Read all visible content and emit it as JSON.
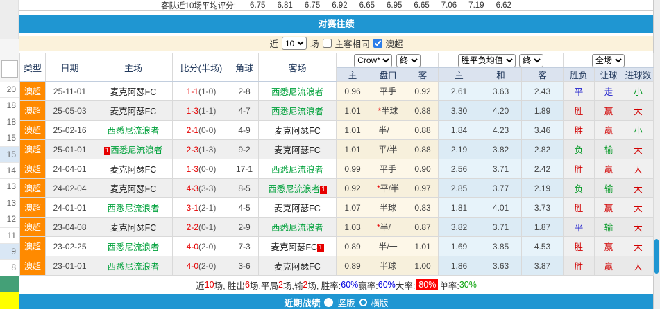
{
  "avg_scores": {
    "label": "客队近10场平均评分:",
    "values": [
      "6.75",
      "6.81",
      "6.75",
      "6.92",
      "6.65",
      "6.95",
      "6.65",
      "7.06",
      "7.19",
      "6.62"
    ]
  },
  "section_title": "对赛往绩",
  "filter": {
    "near": "近",
    "count": "10",
    "unit": "场",
    "same_venue": "主客相同",
    "same_venue_checked": false,
    "league": "澳超",
    "league_checked": true
  },
  "selectors": {
    "bookmaker": "Crow*",
    "final_left": "终",
    "average": "胜平负均值",
    "final_right": "终",
    "scope": "全场"
  },
  "headers": {
    "type": "类型",
    "date": "日期",
    "home": "主场",
    "score": "比分(半场)",
    "corner": "角球",
    "away": "客场",
    "o_home": "主",
    "o_handicap": "盘口",
    "o_away": "客",
    "a_home": "主",
    "a_draw": "和",
    "a_away": "客",
    "r_wdl": "胜负",
    "r_handicap": "让球",
    "r_goals": "进球数"
  },
  "rows": [
    {
      "league": "澳超",
      "date": "25-11-01",
      "home": {
        "n": "麦克阿瑟FC",
        "g": false
      },
      "ft": "1-1",
      "ht": "(1-0)",
      "corner": "2-8",
      "away": {
        "n": "西悉尼流浪者",
        "g": true
      },
      "o1": "0.96",
      "star": false,
      "hc": "平手",
      "o2": "0.92",
      "a1": "2.61",
      "a2": "3.63",
      "a3": "2.43",
      "r": [
        [
          "平",
          "b"
        ],
        [
          "走",
          "b"
        ],
        [
          "小",
          "g"
        ]
      ]
    },
    {
      "league": "澳超",
      "date": "25-05-03",
      "home": {
        "n": "麦克阿瑟FC",
        "g": false
      },
      "ft": "1-3",
      "ht": "(1-1)",
      "corner": "4-7",
      "away": {
        "n": "西悉尼流浪者",
        "g": true
      },
      "o1": "1.01",
      "star": true,
      "hc": "半球",
      "o2": "0.88",
      "a1": "3.30",
      "a2": "4.20",
      "a3": "1.89",
      "r": [
        [
          "胜",
          "r"
        ],
        [
          "赢",
          "r"
        ],
        [
          "大",
          "r"
        ]
      ]
    },
    {
      "league": "澳超",
      "date": "25-02-16",
      "home": {
        "n": "西悉尼流浪者",
        "g": true
      },
      "ft": "2-1",
      "ht": "(0-0)",
      "corner": "4-9",
      "away": {
        "n": "麦克阿瑟FC",
        "g": false
      },
      "o1": "1.01",
      "star": false,
      "hc": "半/一",
      "o2": "0.88",
      "a1": "1.84",
      "a2": "4.23",
      "a3": "3.46",
      "r": [
        [
          "胜",
          "r"
        ],
        [
          "赢",
          "r"
        ],
        [
          "小",
          "g"
        ]
      ]
    },
    {
      "league": "澳超",
      "date": "25-01-01",
      "home": {
        "n": "西悉尼流浪者",
        "g": true,
        "badge": "before"
      },
      "ft": "2-3",
      "ht": "(1-3)",
      "corner": "9-2",
      "away": {
        "n": "麦克阿瑟FC",
        "g": false
      },
      "o1": "1.01",
      "star": false,
      "hc": "平/半",
      "o2": "0.88",
      "a1": "2.19",
      "a2": "3.82",
      "a3": "2.82",
      "r": [
        [
          "负",
          "g"
        ],
        [
          "输",
          "g"
        ],
        [
          "大",
          "r"
        ]
      ]
    },
    {
      "league": "澳超",
      "date": "24-04-01",
      "home": {
        "n": "麦克阿瑟FC",
        "g": false
      },
      "ft": "1-3",
      "ht": "(0-0)",
      "corner": "17-1",
      "away": {
        "n": "西悉尼流浪者",
        "g": true
      },
      "o1": "0.99",
      "star": false,
      "hc": "平手",
      "o2": "0.90",
      "a1": "2.56",
      "a2": "3.71",
      "a3": "2.42",
      "r": [
        [
          "胜",
          "r"
        ],
        [
          "赢",
          "r"
        ],
        [
          "大",
          "r"
        ]
      ]
    },
    {
      "league": "澳超",
      "date": "24-02-04",
      "home": {
        "n": "麦克阿瑟FC",
        "g": false
      },
      "ft": "4-3",
      "ht": "(3-3)",
      "corner": "8-5",
      "away": {
        "n": "西悉尼流浪者",
        "g": true,
        "badge": "after"
      },
      "o1": "0.92",
      "star": true,
      "hc": "平/半",
      "o2": "0.97",
      "a1": "2.85",
      "a2": "3.77",
      "a3": "2.19",
      "r": [
        [
          "负",
          "g"
        ],
        [
          "输",
          "g"
        ],
        [
          "大",
          "r"
        ]
      ]
    },
    {
      "league": "澳超",
      "date": "24-01-01",
      "home": {
        "n": "西悉尼流浪者",
        "g": true
      },
      "ft": "3-1",
      "ht": "(2-1)",
      "corner": "4-5",
      "away": {
        "n": "麦克阿瑟FC",
        "g": false
      },
      "o1": "1.07",
      "star": false,
      "hc": "半球",
      "o2": "0.83",
      "a1": "1.81",
      "a2": "4.01",
      "a3": "3.73",
      "r": [
        [
          "胜",
          "r"
        ],
        [
          "赢",
          "r"
        ],
        [
          "大",
          "r"
        ]
      ]
    },
    {
      "league": "澳超",
      "date": "23-04-08",
      "home": {
        "n": "麦克阿瑟FC",
        "g": false
      },
      "ft": "2-2",
      "ht": "(0-1)",
      "corner": "2-9",
      "away": {
        "n": "西悉尼流浪者",
        "g": true
      },
      "o1": "1.03",
      "star": true,
      "hc": "半/一",
      "o2": "0.87",
      "a1": "3.82",
      "a2": "3.71",
      "a3": "1.87",
      "r": [
        [
          "平",
          "b"
        ],
        [
          "输",
          "g"
        ],
        [
          "大",
          "r"
        ]
      ]
    },
    {
      "league": "澳超",
      "date": "23-02-25",
      "home": {
        "n": "西悉尼流浪者",
        "g": true
      },
      "ft": "4-0",
      "ht": "(2-0)",
      "corner": "7-3",
      "away": {
        "n": "麦克阿瑟FC",
        "g": false,
        "badge": "after"
      },
      "o1": "0.89",
      "star": false,
      "hc": "半/一",
      "o2": "1.01",
      "a1": "1.69",
      "a2": "3.85",
      "a3": "4.53",
      "r": [
        [
          "胜",
          "r"
        ],
        [
          "赢",
          "r"
        ],
        [
          "大",
          "r"
        ]
      ]
    },
    {
      "league": "澳超",
      "date": "23-01-01",
      "home": {
        "n": "西悉尼流浪者",
        "g": true
      },
      "ft": "4-0",
      "ht": "(2-0)",
      "corner": "3-6",
      "away": {
        "n": "麦克阿瑟FC",
        "g": false
      },
      "o1": "0.89",
      "star": false,
      "hc": "半球",
      "o2": "1.00",
      "a1": "1.86",
      "a2": "3.63",
      "a3": "3.87",
      "r": [
        [
          "胜",
          "r"
        ],
        [
          "赢",
          "r"
        ],
        [
          "大",
          "r"
        ]
      ]
    }
  ],
  "summary": [
    {
      "t": "近 ",
      "c": "dark"
    },
    {
      "t": "10",
      "c": "red"
    },
    {
      "t": " 场, 胜出 ",
      "c": "dark"
    },
    {
      "t": "6",
      "c": "red"
    },
    {
      "t": " 场,平局 ",
      "c": "dark"
    },
    {
      "t": "2",
      "c": "red"
    },
    {
      "t": " 场,输 ",
      "c": "dark"
    },
    {
      "t": "2",
      "c": "red"
    },
    {
      "t": " 场, 胜率: ",
      "c": "dark"
    },
    {
      "t": "60%",
      "c": "blue"
    },
    {
      "t": " 赢率: ",
      "c": "dark"
    },
    {
      "t": "60%",
      "c": "blue"
    },
    {
      "t": " 大率: ",
      "c": "dark"
    },
    {
      "t": "80%",
      "c": "redbg"
    },
    {
      "t": " 单率: ",
      "c": "dark"
    },
    {
      "t": "30%",
      "c": "green"
    }
  ],
  "footer": {
    "title": "近期战绩",
    "vertical": "竖版",
    "horizontal": "横版",
    "selected": "竖版"
  },
  "left_strip": {
    "values": [
      "20",
      "18",
      "18",
      "15",
      "15",
      "14",
      "13",
      "13",
      "12",
      "11",
      "9",
      "8"
    ],
    "highlight": [
      4,
      10
    ]
  }
}
